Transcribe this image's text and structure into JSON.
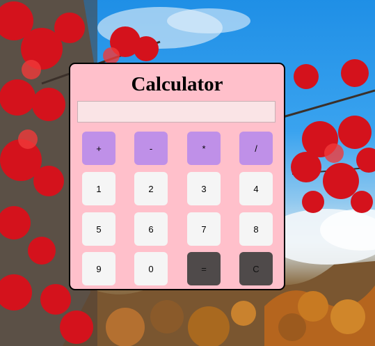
{
  "calculator": {
    "title": "Calculator",
    "display_value": "",
    "keys": [
      {
        "label": "+",
        "type": "operator"
      },
      {
        "label": "-",
        "type": "operator"
      },
      {
        "label": "*",
        "type": "operator"
      },
      {
        "label": "/",
        "type": "operator"
      },
      {
        "label": "1",
        "type": "number"
      },
      {
        "label": "2",
        "type": "number"
      },
      {
        "label": "3",
        "type": "number"
      },
      {
        "label": "4",
        "type": "number"
      },
      {
        "label": "5",
        "type": "number"
      },
      {
        "label": "6",
        "type": "number"
      },
      {
        "label": "7",
        "type": "number"
      },
      {
        "label": "8",
        "type": "number"
      },
      {
        "label": "9",
        "type": "number"
      },
      {
        "label": "0",
        "type": "number"
      },
      {
        "label": "=",
        "type": "equals"
      },
      {
        "label": "C",
        "type": "clear"
      }
    ]
  },
  "colors": {
    "panel": "#ffc0cb",
    "display": "#fae4e6",
    "operator_key": "#bf90e8",
    "number_key": "#f5f5f5",
    "dark_key": "#4f4a4a"
  },
  "background": {
    "description_icon": "autumn-maple-landscape-image"
  }
}
